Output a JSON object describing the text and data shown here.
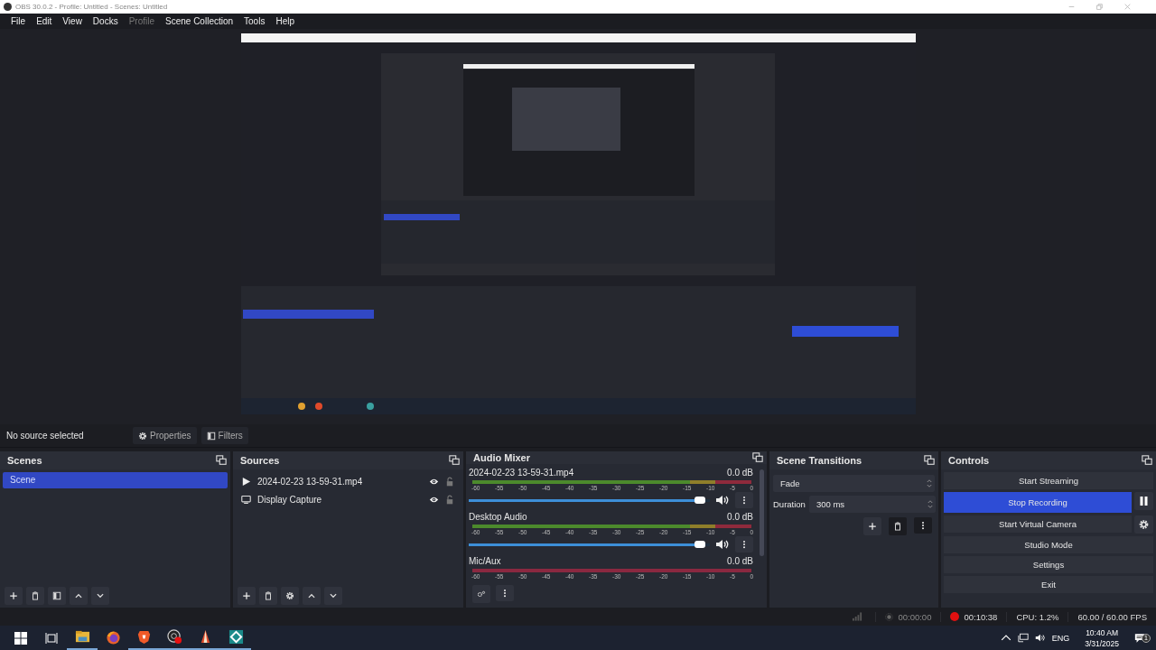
{
  "window": {
    "title": "OBS 30.0.2 - Profile: Untitled - Scenes: Untitled"
  },
  "menu": [
    {
      "label": "File",
      "disabled": false
    },
    {
      "label": "Edit",
      "disabled": false
    },
    {
      "label": "View",
      "disabled": false
    },
    {
      "label": "Docks",
      "disabled": false
    },
    {
      "label": "Profile",
      "disabled": true
    },
    {
      "label": "Scene Collection",
      "disabled": false
    },
    {
      "label": "Tools",
      "disabled": false
    },
    {
      "label": "Help",
      "disabled": false
    }
  ],
  "source_toolbar": {
    "status": "No source selected",
    "buttons": [
      {
        "label": "Properties",
        "kind": "gear"
      },
      {
        "label": "Filters",
        "kind": "filter"
      }
    ]
  },
  "scenes": {
    "title": "Scenes",
    "items": [
      {
        "label": "Scene",
        "selected": true
      }
    ]
  },
  "sources": {
    "title": "Sources",
    "items": [
      {
        "label": "2024-02-23 13-59-31.mp4",
        "kind": "media",
        "visible": true,
        "locked": false
      },
      {
        "label": "Display Capture",
        "kind": "display",
        "visible": true,
        "locked": false
      }
    ]
  },
  "audio_mixer": {
    "title": "Audio Mixer",
    "channels": [
      {
        "name": "2024-02-23 13-59-31.mp4",
        "reading": "0.0 dB",
        "active": true,
        "level": 0.98,
        "muted": false,
        "scale": [
          "-60",
          "-55",
          "-50",
          "-45",
          "-40",
          "-35",
          "-30",
          "-25",
          "-20",
          "-15",
          "-10",
          "-5",
          "0"
        ]
      },
      {
        "name": "Desktop Audio",
        "reading": "0.0 dB",
        "active": true,
        "level": 0.98,
        "muted": false,
        "scale": [
          "-60",
          "-55",
          "-50",
          "-45",
          "-40",
          "-35",
          "-30",
          "-25",
          "-20",
          "-15",
          "-10",
          "-5",
          "0"
        ]
      },
      {
        "name": "Mic/Aux",
        "reading": "0.0 dB",
        "active": false,
        "scale": [
          "-60",
          "-55",
          "-50",
          "-45",
          "-40",
          "-35",
          "-30",
          "-25",
          "-20",
          "-15",
          "-10",
          "-5",
          "0"
        ]
      }
    ]
  },
  "scene_transitions": {
    "title": "Scene Transitions",
    "transition": "Fade",
    "duration_label": "Duration",
    "duration": "300 ms"
  },
  "controls": {
    "title": "Controls",
    "buttons": [
      {
        "label": "Start Streaming",
        "active": false
      },
      {
        "label": "Stop Recording",
        "active": true,
        "side": {
          "kind": "pause"
        }
      },
      {
        "label": "Start Virtual Camera",
        "active": false,
        "side": {
          "kind": "gear"
        }
      },
      {
        "label": "Studio Mode",
        "active": false
      },
      {
        "label": "Settings",
        "active": false
      },
      {
        "label": "Exit",
        "active": false
      }
    ]
  },
  "status_bar": {
    "stream_time": "00:00:00",
    "record_time": "00:10:38",
    "recording": true,
    "cpu": "CPU: 1.2%",
    "fps": "60.00 / 60.00 FPS"
  },
  "taskbar": {
    "apps": [
      {
        "kind": "folder",
        "running": true
      },
      {
        "kind": "browser",
        "running": false
      },
      {
        "kind": "shield",
        "running": true
      },
      {
        "kind": "recorder",
        "running": true
      },
      {
        "kind": "pencil",
        "running": true
      },
      {
        "kind": "diamond",
        "running": true
      }
    ],
    "language": "ENG",
    "time": "10:40 AM",
    "date": "3/31/2025",
    "notifications": "1"
  }
}
